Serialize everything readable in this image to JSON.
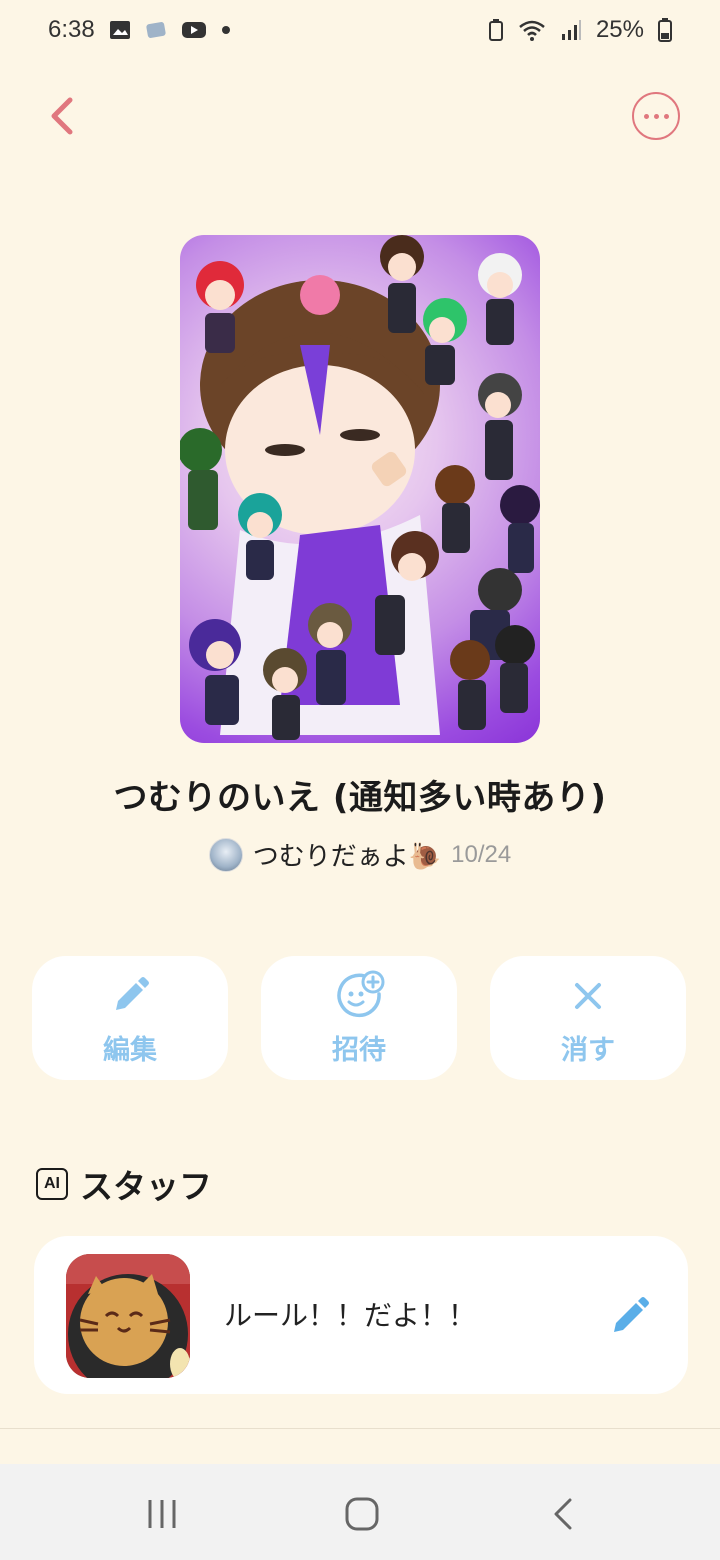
{
  "status_bar": {
    "time": "6:38",
    "battery": "25%"
  },
  "room": {
    "title": "つむりのいえ (通知多い時あり)",
    "owner_name": "つむりだぁよ🐌",
    "date": "10/24"
  },
  "actions": [
    {
      "label": "編集",
      "icon": "pencil-icon"
    },
    {
      "label": "招待",
      "icon": "add-user-icon"
    },
    {
      "label": "消す",
      "icon": "close-icon"
    }
  ],
  "staff_section": {
    "badge": "AI",
    "title": "スタッフ",
    "item": {
      "name": "ルール！！だよ！！"
    }
  },
  "colors": {
    "accent": "#e0777e",
    "action_blue": "#8ec6ee",
    "background": "#fdf6e6"
  }
}
